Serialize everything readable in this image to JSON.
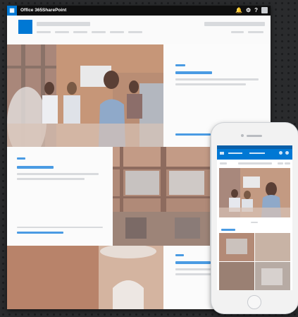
{
  "suite_bar": {
    "brand": "Office 365",
    "app": "SharePoint",
    "icons": [
      "waffle-icon",
      "bell-icon",
      "gear-icon",
      "help-icon",
      "profile-icon"
    ]
  },
  "colors": {
    "accent": "#0078d4",
    "suite_bar": "#0f0f0f",
    "page_bg": "#f4f5f6",
    "placeholder": "#d8dadd"
  }
}
